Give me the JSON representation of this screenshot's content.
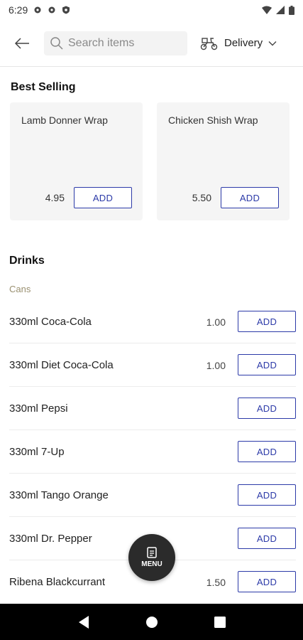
{
  "status": {
    "time": "6:29"
  },
  "header": {
    "search_placeholder": "Search items",
    "delivery_label": "Delivery"
  },
  "best_selling": {
    "title": "Best Selling",
    "items": [
      {
        "name": "Lamb Donner Wrap",
        "price": "4.95",
        "add": "ADD"
      },
      {
        "name": "Chicken Shish Wrap",
        "price": "5.50",
        "add": "ADD"
      }
    ]
  },
  "drinks": {
    "title": "Drinks",
    "subcategory": "Cans",
    "items": [
      {
        "name": "330ml Coca-Cola",
        "price": "1.00",
        "add": "ADD"
      },
      {
        "name": "330ml Diet Coca-Cola",
        "price": "1.00",
        "add": "ADD"
      },
      {
        "name": "330ml Pepsi",
        "price": "",
        "add": "ADD"
      },
      {
        "name": "330ml 7-Up",
        "price": "",
        "add": "ADD"
      },
      {
        "name": "330ml Tango Orange",
        "price": "",
        "add": "ADD"
      },
      {
        "name": "330ml Dr. Pepper",
        "price": "",
        "add": "ADD"
      },
      {
        "name": "Ribena Blackcurrant",
        "price": "1.50",
        "add": "ADD"
      }
    ]
  },
  "fab": {
    "label": "MENU"
  },
  "colors": {
    "accent": "#2c3aa8",
    "card_bg": "#f5f5f5",
    "subcategory": "#9a9070"
  },
  "icons": [
    "settings-icon",
    "shield-icon",
    "wifi-icon",
    "signal-icon",
    "battery-icon",
    "back-arrow-icon",
    "search-icon",
    "delivery-scooter-icon",
    "chevron-down-icon",
    "menu-document-icon",
    "nav-back-icon",
    "nav-home-icon",
    "nav-recents-icon"
  ]
}
